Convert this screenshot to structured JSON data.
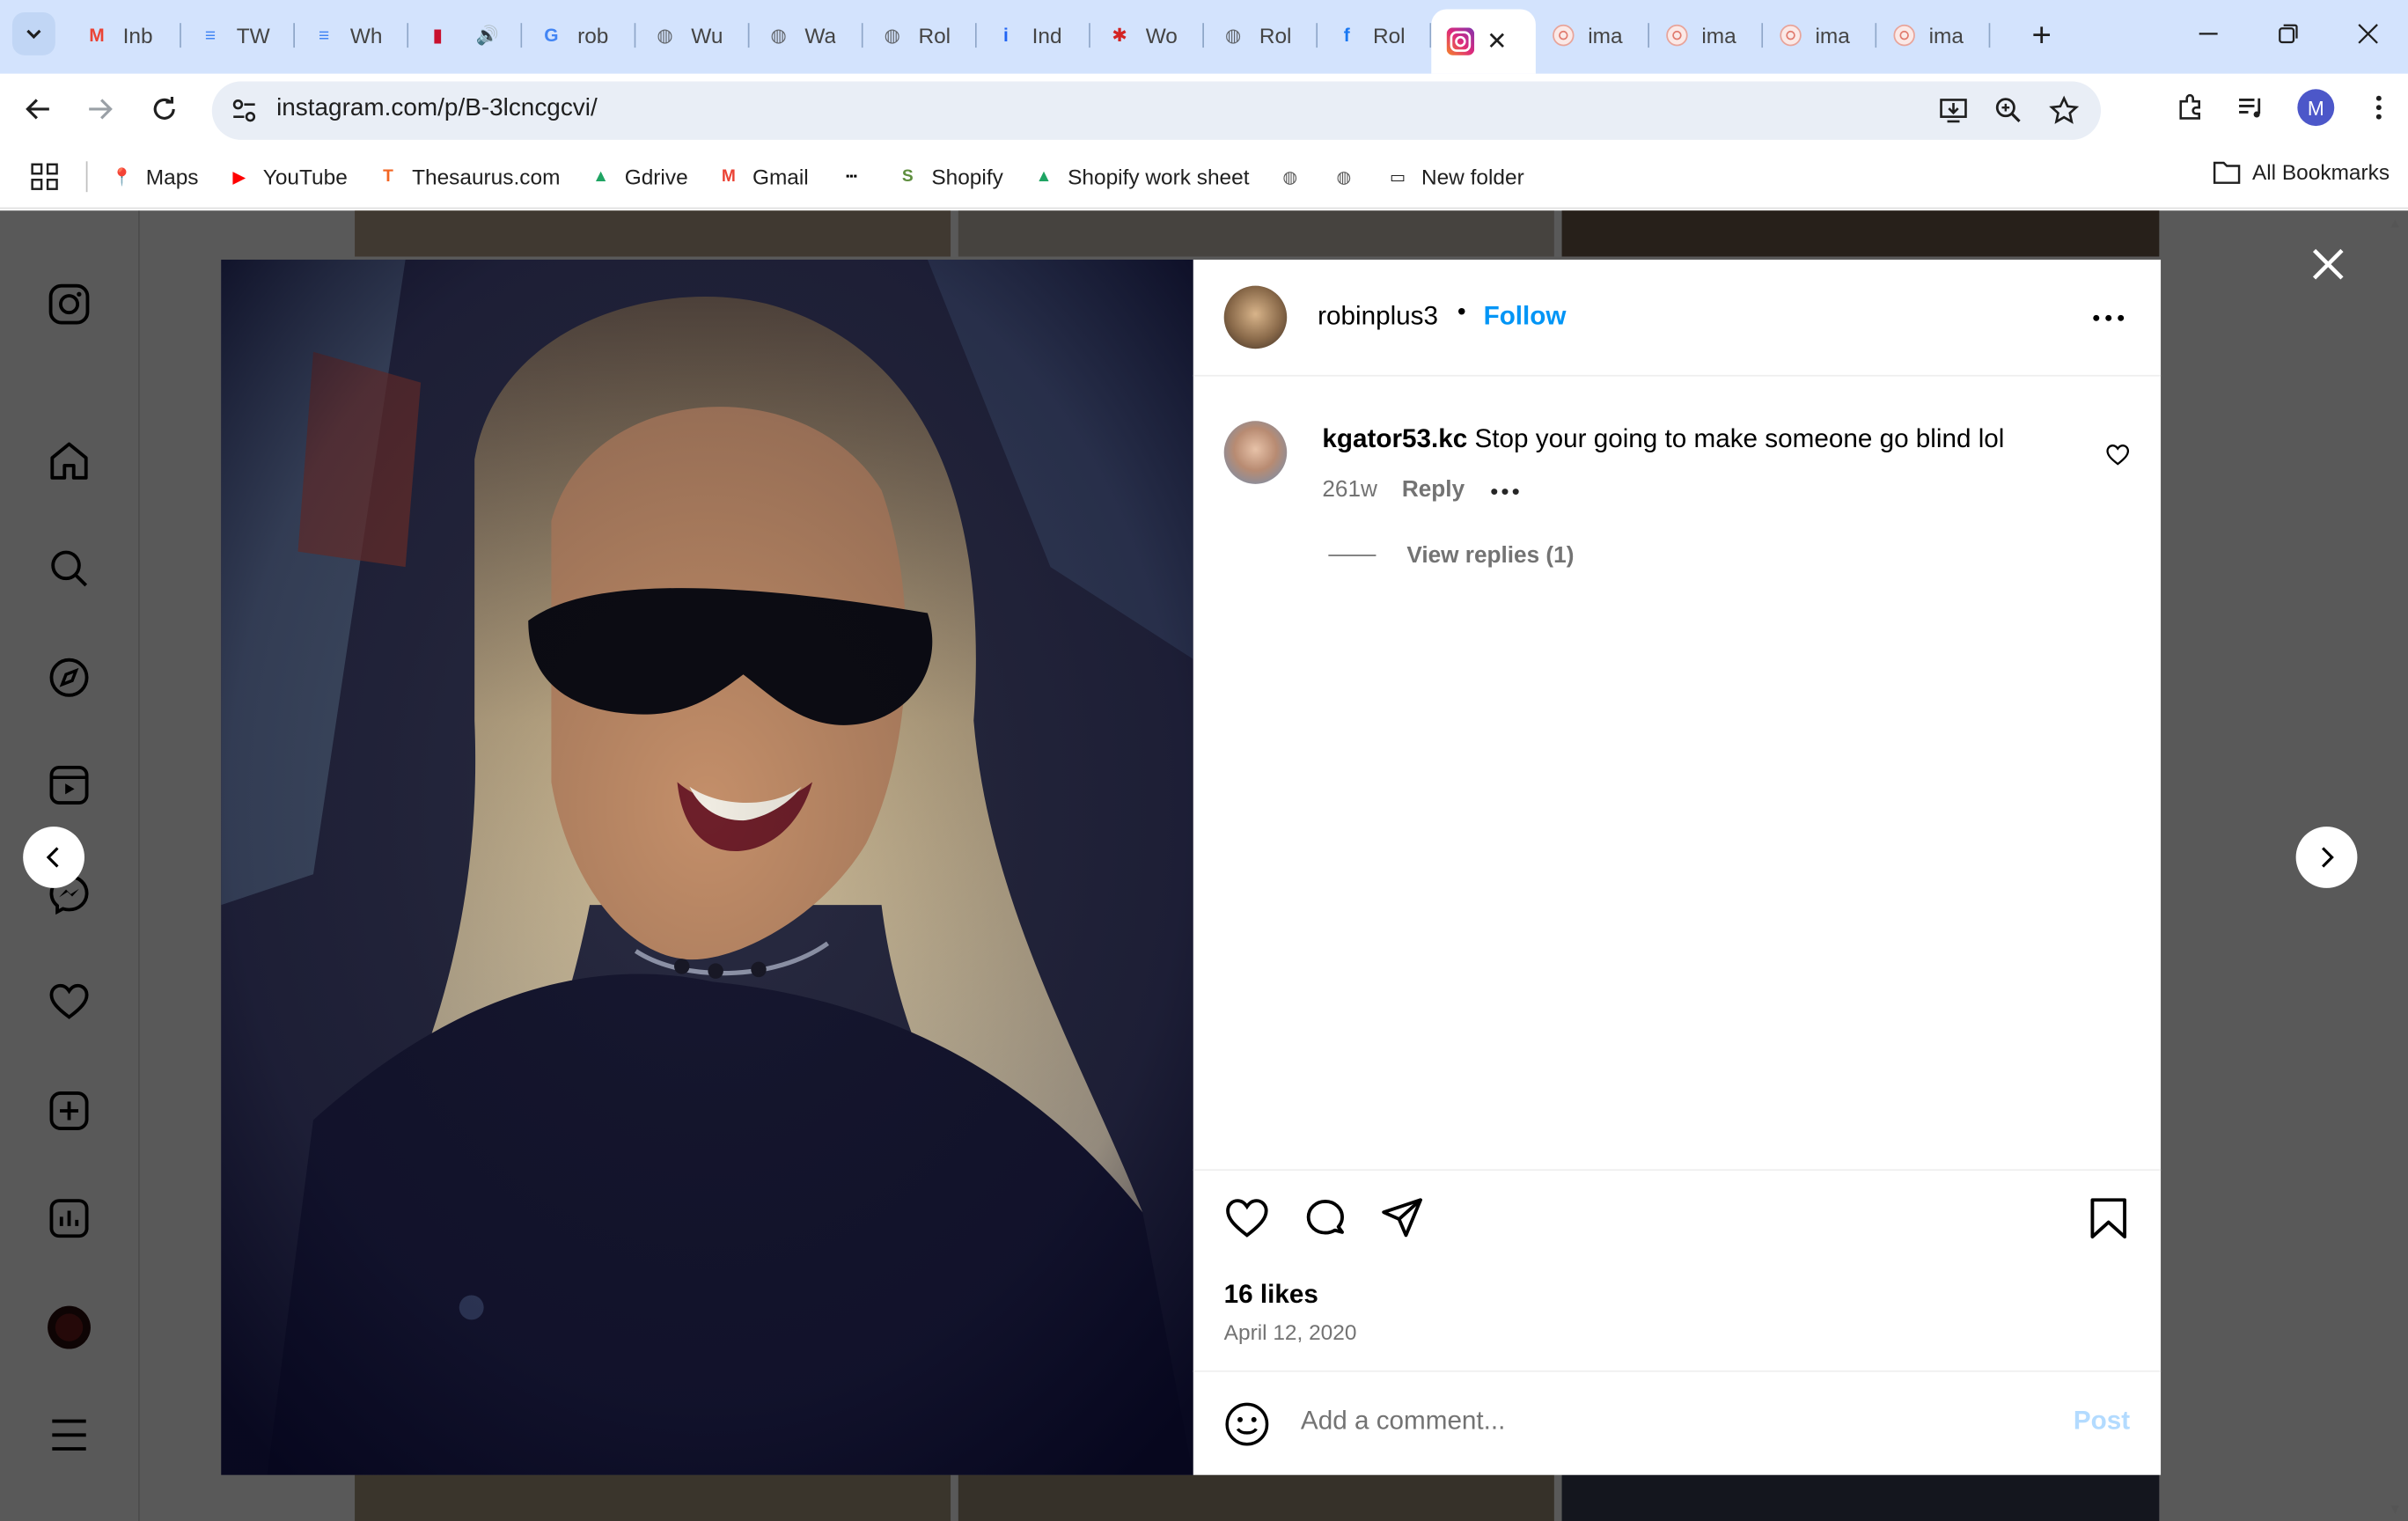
{
  "browser": {
    "tabs": [
      {
        "title": "Inbox",
        "favicon": "gmail-icon",
        "color": "#ea4335",
        "short": "Inb"
      },
      {
        "title": "TW",
        "favicon": "docs-icon",
        "color": "#4285f4",
        "short": "TW"
      },
      {
        "title": "Wh",
        "favicon": "docs-icon",
        "color": "#4285f4",
        "short": "Wh"
      },
      {
        "title": "",
        "favicon": "nba-icon",
        "color": "#c8102e",
        "short": ""
      },
      {
        "title": "rob",
        "favicon": "google-icon",
        "color": "#4285f4",
        "short": "rob"
      },
      {
        "title": "Wu",
        "favicon": "globe-icon",
        "color": "#5f6368",
        "short": "Wu"
      },
      {
        "title": "Wa",
        "favicon": "globe-icon",
        "color": "#5f6368",
        "short": "Wa"
      },
      {
        "title": "Rol",
        "favicon": "globe-icon",
        "color": "#5f6368",
        "short": "Rol"
      },
      {
        "title": "Ind",
        "favicon": "indeed-icon",
        "color": "#2164f3",
        "short": "Ind"
      },
      {
        "title": "Wo",
        "favicon": "yelp-icon",
        "color": "#d32323",
        "short": "Wo"
      },
      {
        "title": "Rol",
        "favicon": "globe-icon",
        "color": "#5f6368",
        "short": "Rol"
      },
      {
        "title": "Rol",
        "favicon": "facebook-icon",
        "color": "#1877f2",
        "short": "Rol"
      }
    ],
    "after_tabs": [
      {
        "short": "ima"
      },
      {
        "short": "ima"
      },
      {
        "short": "ima"
      },
      {
        "short": "ima"
      }
    ],
    "url": "instagram.com/p/B-3lcncgcvi/",
    "profile_initial": "M",
    "bookmarks": [
      {
        "label": "Maps",
        "icon": "maps-icon"
      },
      {
        "label": "YouTube",
        "icon": "youtube-icon"
      },
      {
        "label": "Thesaurus.com",
        "icon": "thesaurus-icon"
      },
      {
        "label": "Gdrive",
        "icon": "drive-icon"
      },
      {
        "label": "Gmail",
        "icon": "gmail-icon"
      },
      {
        "label": "",
        "icon": "bbc-icon"
      },
      {
        "label": "Shopify",
        "icon": "shopify-icon"
      },
      {
        "label": "Shopify work sheet",
        "icon": "drive-icon"
      },
      {
        "label": "",
        "icon": "globe-icon"
      },
      {
        "label": "",
        "icon": "globe-icon"
      },
      {
        "label": "New folder",
        "icon": "folder-icon"
      }
    ],
    "all_bookmarks": "All Bookmarks"
  },
  "post": {
    "username": "robinplus3",
    "separator": "•",
    "follow": "Follow",
    "comment": {
      "username": "kgator53.kc",
      "text": "Stop your going to make someone go blind lol",
      "age": "261w",
      "reply": "Reply",
      "view_replies": "View replies (1)"
    },
    "likes": "16 likes",
    "date": "April 12, 2020",
    "add_comment_placeholder": "Add a comment...",
    "post_button": "Post"
  },
  "colors": {
    "accent": "#0095f6",
    "tab_bg": "#d3e3fd",
    "omnibox_bg": "#e9eef6"
  }
}
